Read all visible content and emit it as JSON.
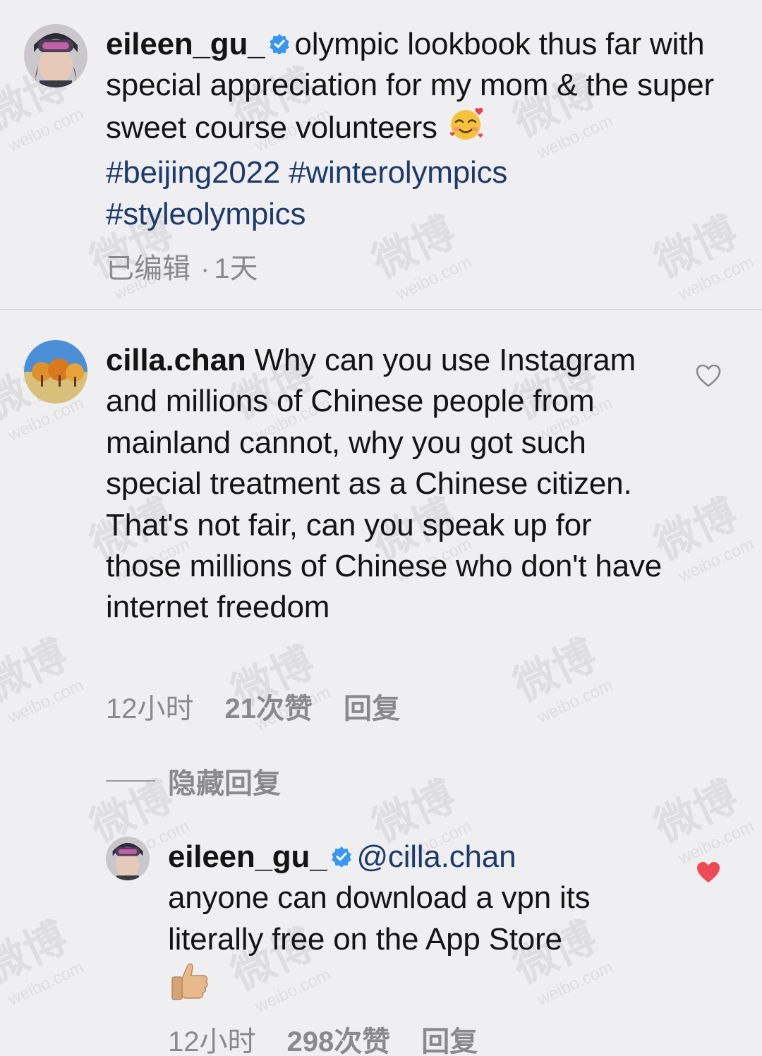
{
  "post": {
    "username": "eileen_gu_",
    "caption": "olympic lookbook thus far with special appreciation for my mom & the super sweet course volunteers",
    "hashtags": [
      "#beijing2022",
      "#winterolympics",
      "#styleolympics"
    ],
    "edited_label": "已编辑",
    "time": "1天",
    "emoji": "smiling-face-with-hearts"
  },
  "comment": {
    "username": "cilla.chan",
    "text": "Why can you use Instagram and millions of Chinese people from mainland cannot, why you got such special treatment as a Chinese citizen. That's not fair, can you speak up for those millions of Chinese who don't have internet freedom",
    "time": "12小时",
    "likes": "21次赞",
    "reply_label": "回复",
    "liked": false
  },
  "hide_replies_label": "隐藏回复",
  "reply": {
    "username": "eileen_gu_",
    "mention": "@cilla.chan",
    "text": "anyone can download a vpn its literally free on the App Store",
    "emoji": "thumbs-up",
    "time": "12小时",
    "likes": "298次赞",
    "reply_label": "回复",
    "liked": true
  },
  "watermark": {
    "cn": "微博",
    "en": "weibo.com"
  },
  "colors": {
    "background": "#efeef0",
    "hashtag": "#1d3a6b",
    "verified": "#3897f0",
    "heart": "#ed4956",
    "meta": "#8a8a8e"
  }
}
